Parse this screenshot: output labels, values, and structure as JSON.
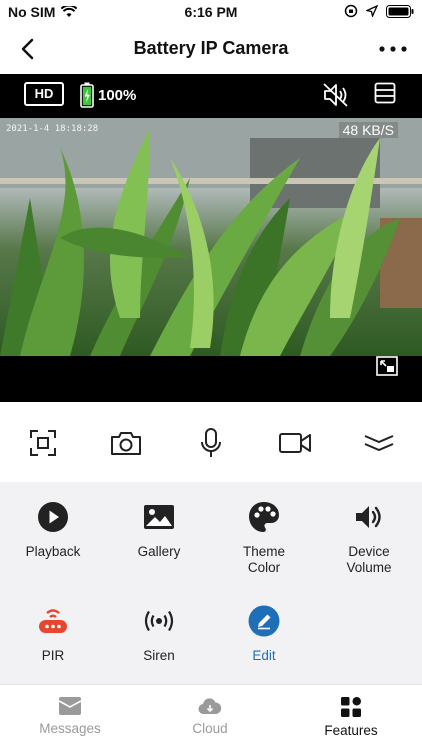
{
  "status_bar": {
    "carrier": "No SIM",
    "time": "6:16 PM"
  },
  "nav": {
    "title": "Battery IP Camera"
  },
  "video": {
    "quality": "HD",
    "battery_percent": "100%",
    "timestamp": "2021-1-4 18:18:28",
    "speed": "48 KB/S"
  },
  "features": [
    {
      "label": "Playback",
      "icon": "play-circle-icon"
    },
    {
      "label": "Gallery",
      "icon": "gallery-icon"
    },
    {
      "label": "Theme\nColor",
      "icon": "palette-icon"
    },
    {
      "label": "Device\nVolume",
      "icon": "volume-icon"
    },
    {
      "label": "PIR",
      "icon": "pir-sensor-icon"
    },
    {
      "label": "Siren",
      "icon": "siren-icon"
    },
    {
      "label": "Edit",
      "icon": "edit-icon"
    }
  ],
  "tabs": [
    {
      "label": "Messages",
      "icon": "envelope-icon"
    },
    {
      "label": "Cloud",
      "icon": "cloud-icon"
    },
    {
      "label": "Features",
      "icon": "grid-icon"
    }
  ],
  "colors": {
    "accent_blue": "#1f6fb8",
    "pir_red": "#e8452f",
    "tab_active": "#111111",
    "tab_inactive": "#9a9a9a"
  }
}
